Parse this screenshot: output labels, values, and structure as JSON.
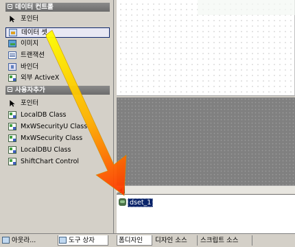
{
  "toolbox": {
    "groups": [
      {
        "title": "데이터 컨트롤",
        "items": [
          {
            "label": "포인터",
            "icon": "pointer-icon"
          },
          {
            "label": "데이터 셋",
            "icon": "dataset-icon",
            "selected": true
          },
          {
            "label": "이미지",
            "icon": "image-icon"
          },
          {
            "label": "트랜잭션",
            "icon": "transaction-icon"
          },
          {
            "label": "바인더",
            "icon": "binder-icon"
          },
          {
            "label": "외부 ActiveX",
            "icon": "activex-icon"
          }
        ]
      },
      {
        "title": "사용자추가",
        "items": [
          {
            "label": "포인터",
            "icon": "pointer-icon"
          },
          {
            "label": "LocalDB Class",
            "icon": "com-component-icon"
          },
          {
            "label": "MxWSecurityU Class",
            "icon": "com-component-icon"
          },
          {
            "label": "MxWSecurity Class",
            "icon": "com-component-icon"
          },
          {
            "label": "LocalDBU Class",
            "icon": "com-component-icon"
          },
          {
            "label": "ShiftChart Control",
            "icon": "com-component-icon"
          }
        ]
      }
    ],
    "tabs": [
      {
        "label": "아웃라...",
        "icon": "outline-icon"
      },
      {
        "label": "도구 상자",
        "icon": "toolbox-icon",
        "active": true
      }
    ]
  },
  "designer": {
    "tray_component": {
      "label": "dset_1",
      "icon": "dataset-component-icon"
    },
    "tabs": [
      {
        "label": "폼디자인",
        "active": true
      },
      {
        "label": "디자인 소스"
      },
      {
        "label": "스크립트 소스"
      }
    ]
  },
  "colors": {
    "selection": "#0a246a",
    "group_header": "#7a7a7a",
    "drag_arrow_start": "#ffff00",
    "drag_arrow_end": "#ff3300"
  }
}
